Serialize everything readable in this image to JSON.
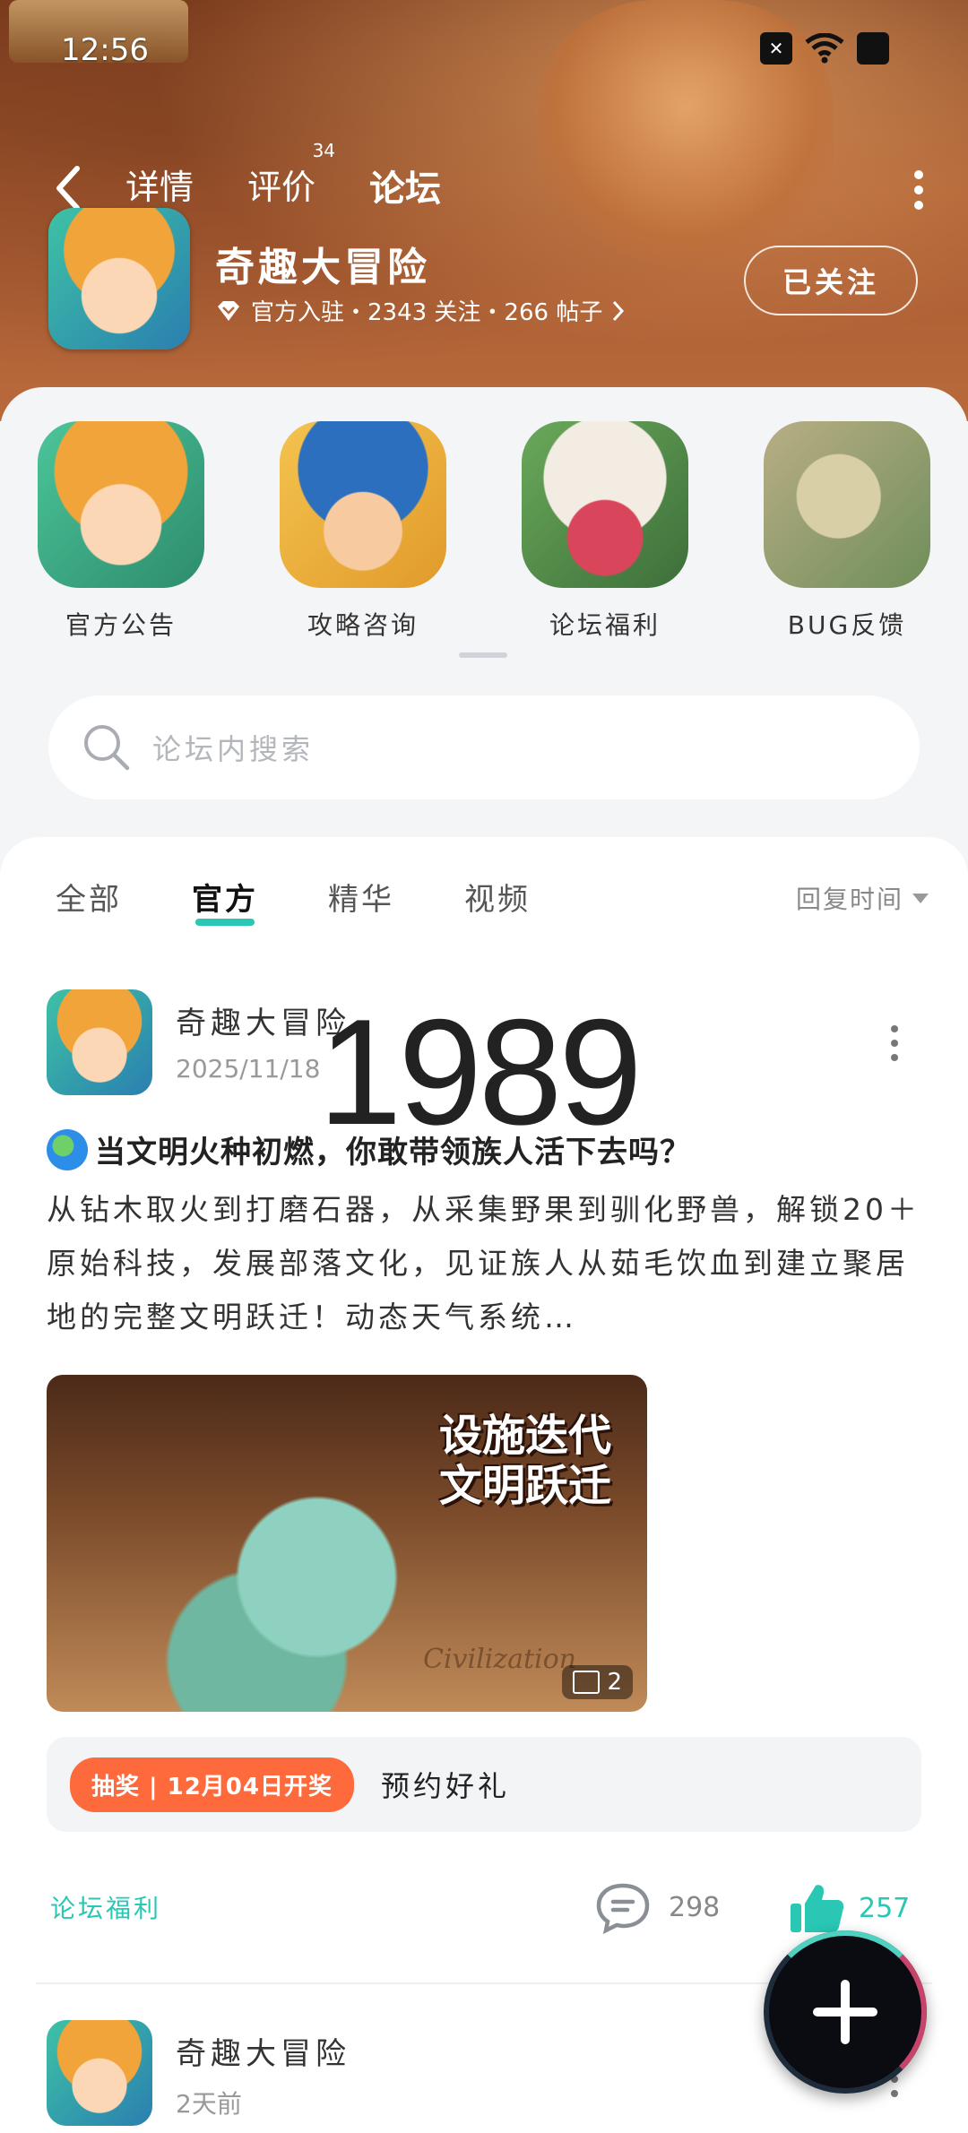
{
  "status_bar": {
    "time": "12:56"
  },
  "header": {
    "tabs": [
      {
        "label": "详情",
        "badge": ""
      },
      {
        "label": "评价",
        "badge": "34"
      },
      {
        "label": "论坛",
        "badge": ""
      }
    ],
    "active_tab": "论坛",
    "accent_color": "#29c7b4"
  },
  "game": {
    "title": "奇趣大冒险",
    "meta": "官方入驻・2343 关注・266 帖子",
    "follow_label": "已关注"
  },
  "categories": [
    {
      "label": "官方公告"
    },
    {
      "label": "攻略咨询"
    },
    {
      "label": "论坛福利"
    },
    {
      "label": "BUG反馈"
    }
  ],
  "search": {
    "placeholder": "论坛内搜索"
  },
  "filters": {
    "items": [
      "全部",
      "官方",
      "精华",
      "视频"
    ],
    "active": "官方",
    "sort_label": "回复时间"
  },
  "watermark": "1989",
  "posts": [
    {
      "author": "奇趣大冒险",
      "date": "2025/11/18",
      "title": "当文明火种初燃，你敢带领族人活下去吗？",
      "body": "从钻木取火到打磨石器，从采集野果到驯化野兽，解锁20＋原始科技，发展部落文化，见证族人从茹毛饮血到建立聚居地的完整文明跃迁！动态天气系统…",
      "image_text_line1": "设施迭代",
      "image_text_line2": "文明跃迁",
      "image_watermark": "Civilization",
      "image_count": "2",
      "event_tag": "抽奖 | 12月04日开奖",
      "event_text": "预约好礼",
      "tag_link": "论坛福利",
      "comments": "298",
      "likes": "257"
    },
    {
      "author": "奇趣大冒险",
      "date": "2天前"
    }
  ]
}
